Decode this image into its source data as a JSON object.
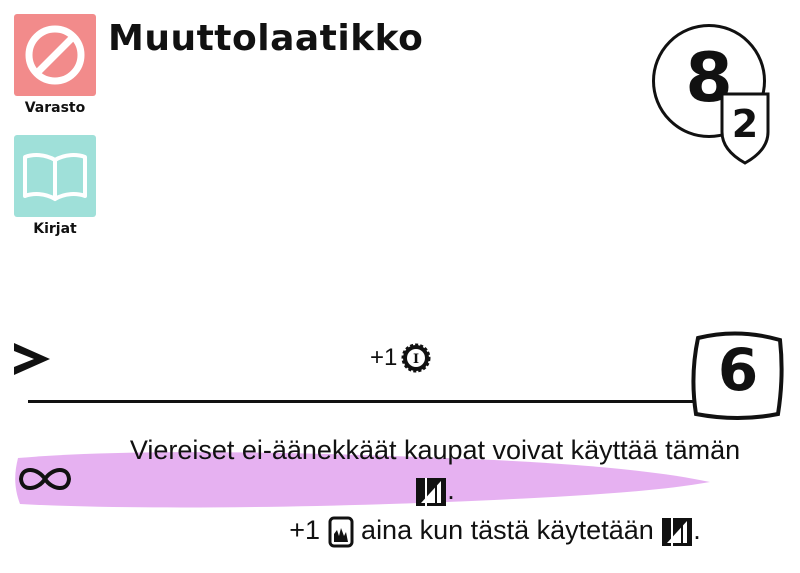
{
  "tags": [
    {
      "label": "Varasto",
      "icon": "no-entry-icon",
      "color": "#f28b8b"
    },
    {
      "label": "Kirjat",
      "icon": "open-book-icon",
      "color": "#9fe0d9"
    }
  ],
  "card": {
    "title": "Muuttolaatikko",
    "cost": "8",
    "secondary_cost": "2",
    "trigger_icon": "chevron-right-icon",
    "bonus_text": "+1",
    "bonus_icon": "coin-icon",
    "victory_points": "6",
    "highlight_color": "#e3a8f0",
    "ability": {
      "icon": "infinity-icon",
      "line1": "Viereiset ei-äänekkäät kaupat voivat käyttää tämän",
      "line2_suffix": ".",
      "line3_prefix": "+1",
      "line3_mid": "aina kun tästä käytetään",
      "line3_suffix": "."
    }
  }
}
